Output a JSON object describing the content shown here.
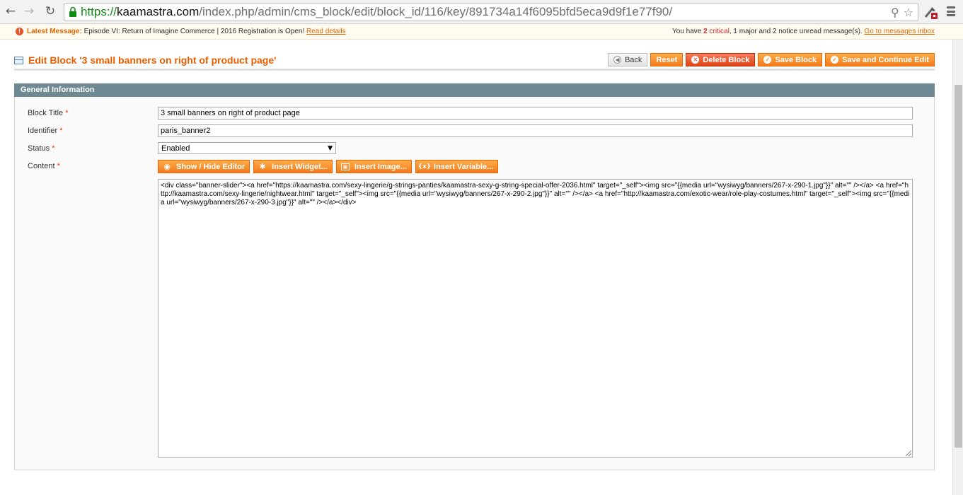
{
  "browser": {
    "url_protocol": "https://",
    "url_host": "kaamastra.com",
    "url_path": "/index.php/admin/cms_block/edit/block_id/116/key/891734a14f6095bfd5eca9d9f1e77f90/"
  },
  "notice": {
    "label": "Latest Message:",
    "message": "Episode VI: Return of Imagine Commerce | 2016 Registration is Open!",
    "link": "Read details",
    "summary_prefix": "You have",
    "critical_count": "2",
    "critical_label": "critical",
    "major_text": ", 1 major and 2 notice unread message(s).",
    "inbox_link": "Go to messages inbox"
  },
  "header": {
    "title": "Edit Block '3 small banners on right of product page'",
    "buttons": {
      "back": "Back",
      "reset": "Reset",
      "delete": "Delete Block",
      "save": "Save Block",
      "save_continue": "Save and Continue Edit"
    }
  },
  "section": {
    "title": "General Information"
  },
  "form": {
    "block_title_label": "Block Title",
    "block_title_value": "3 small banners on right of product page",
    "identifier_label": "Identifier",
    "identifier_value": "paris_banner2",
    "status_label": "Status",
    "status_value": "Enabled",
    "content_label": "Content",
    "required_mark": "*",
    "editor_buttons": {
      "show_hide": "Show / Hide Editor",
      "insert_widget": "Insert Widget...",
      "insert_image": "Insert Image...",
      "insert_variable": "Insert Variable..."
    },
    "content_value": "<div class=\"banner-slider\"><a href=\"https://kaamastra.com/sexy-lingerie/g-strings-panties/kaamastra-sexy-g-string-special-offer-2036.html\" target=\"_self\"><img src=\"{{media url=\"wysiwyg/banners/267-x-290-1.jpg\"}}\" alt=\"\" /></a> <a href=\"http://kaamastra.com/sexy-lingerie/nightwear.html\" target=\"_self\"><img src=\"{{media url=\"wysiwyg/banners/267-x-290-2.jpg\"}}\" alt=\"\" /></a> <a href=\"http://kaamastra.com/exotic-wear/role-play-costumes.html\" target=\"_self\"><img src=\"{{media url=\"wysiwyg/banners/267-x-290-3.jpg\"}}\" alt=\"\" /></a></div>"
  },
  "colors": {
    "accent_orange": "#eb5e00",
    "section_header": "#6f8992",
    "url_secure_green": "#128a12"
  }
}
